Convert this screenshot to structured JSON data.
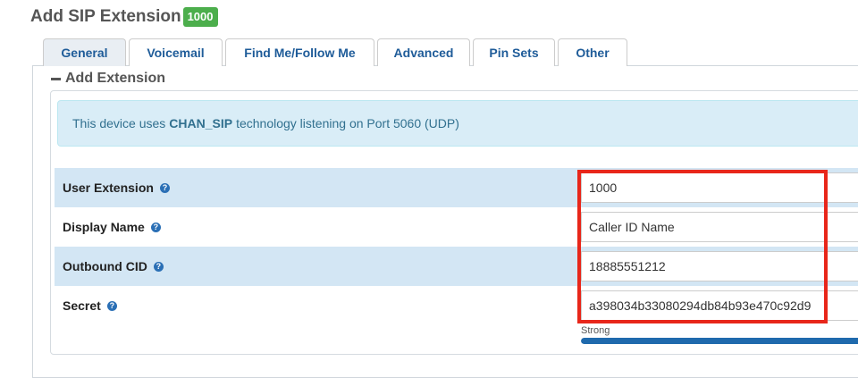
{
  "header": {
    "title": "Add SIP Extension",
    "extension_badge": "1000"
  },
  "tabs": [
    {
      "label": "General",
      "active": true
    },
    {
      "label": "Voicemail",
      "active": false
    },
    {
      "label": "Find Me/Follow Me",
      "active": false
    },
    {
      "label": "Advanced",
      "active": false
    },
    {
      "label": "Pin Sets",
      "active": false
    },
    {
      "label": "Other",
      "active": false
    }
  ],
  "section": {
    "title": "Add Extension",
    "collapse_icon": "minus-icon"
  },
  "info": {
    "prefix": "This device uses",
    "technology": "CHAN_SIP",
    "suffix": "technology listening on Port 5060 (UDP)"
  },
  "form": {
    "user_extension": {
      "label": "User Extension",
      "value": "1000"
    },
    "display_name": {
      "label": "Display Name",
      "value": "Caller ID Name"
    },
    "outbound_cid": {
      "label": "Outbound CID",
      "value": "18885551212"
    },
    "secret": {
      "label": "Secret",
      "value": "a398034b33080294db84b93e470c92d9"
    }
  },
  "password_strength": {
    "label": "Strong",
    "level_percent": 100
  },
  "help_icon_glyph": "?",
  "colors": {
    "badge": "#4cae4c",
    "link": "#1f5c99",
    "row_highlight": "#d3e6f4",
    "info_bg": "#d9edf7",
    "annotation": "#e8261a",
    "strength_bar": "#1f6aad"
  }
}
